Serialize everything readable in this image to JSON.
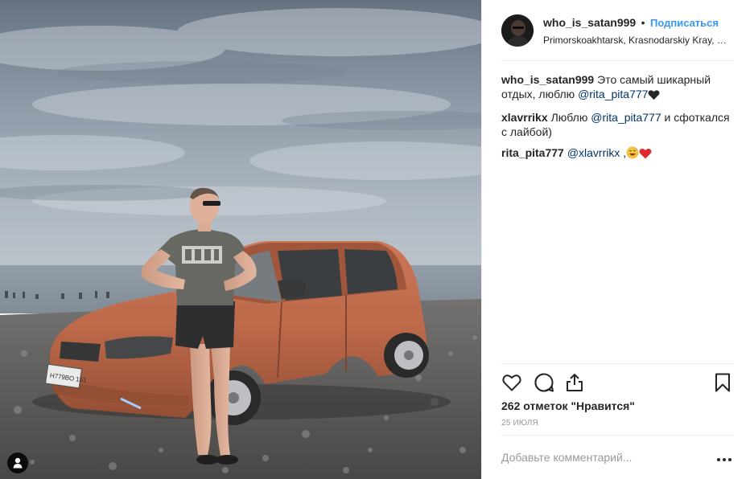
{
  "post": {
    "author": "who_is_satan999",
    "follow_label": "Подписаться",
    "location": "Primorskoakhtarsk, Krasnodarskiy Kray, Ru...",
    "plate_text": "Н779ВО 161"
  },
  "comments": [
    {
      "user": "who_is_satan999",
      "text": "Это самый шикарный отдых, люблю ",
      "mention": "@rita_pita777",
      "after": "",
      "emoji": "black-heart"
    },
    {
      "user": "xlavrrikx",
      "text": "Люблю ",
      "mention": "@rita_pita777",
      "after": " и сфоткался с лайбой)",
      "emoji": ""
    },
    {
      "user": "rita_pita777",
      "text": "",
      "mention": "@xlavrrikx",
      "after": " ,",
      "emoji": "grin-sweat red-heart"
    }
  ],
  "likes_text": "262 отметок \"Нравится\"",
  "date_text": "25 ИЮЛЯ",
  "add_comment": {
    "placeholder": "Добавьте комментарий..."
  },
  "icons": {
    "like": "heart-outline-icon",
    "comment": "speech-bubble-icon",
    "share": "share-upload-icon",
    "save": "bookmark-icon",
    "more": "more-dots-icon",
    "tag": "user-tag-icon"
  },
  "colors": {
    "link": "#3897f0",
    "mention": "#003569",
    "muted": "#999999",
    "heart_red": "#ed4956"
  }
}
